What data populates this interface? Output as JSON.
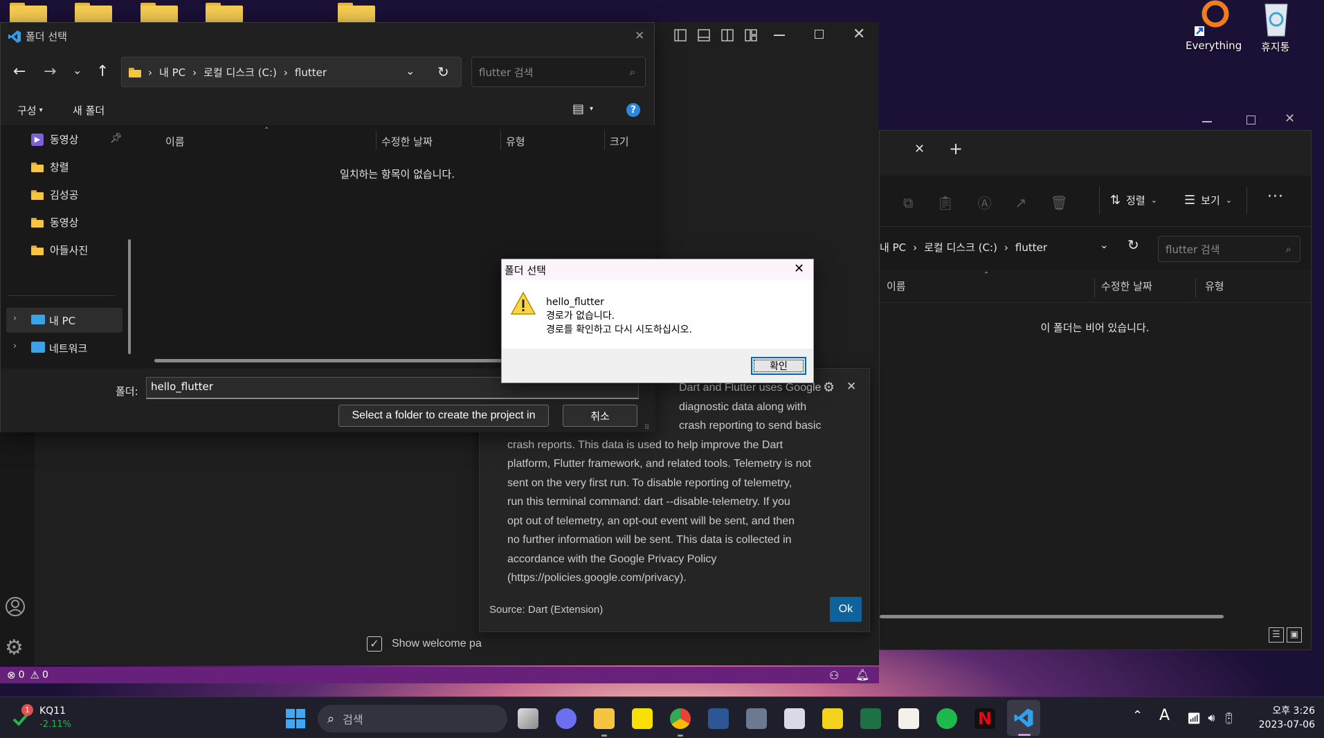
{
  "desktop": {
    "icons": [
      {
        "label": "Everything"
      },
      {
        "label": "휴지통"
      }
    ]
  },
  "vscode": {
    "status": {
      "errors": "0",
      "warnings": "0"
    },
    "welcome_checkbox_label": "Show welcome pa"
  },
  "explorer": {
    "toolbar": {
      "sort_label": "정렬",
      "view_label": "보기"
    },
    "address": {
      "segments": [
        "내 PC",
        "로컬 디스크 (C:)",
        "flutter"
      ]
    },
    "search_placeholder": "flutter 검색",
    "columns": [
      "이름",
      "수정한 날짜",
      "유형"
    ],
    "empty_message": "이 폴더는 비어 있습니다."
  },
  "picker": {
    "title": "폴더 선택",
    "address": {
      "segments": [
        "내 PC",
        "로컬 디스크 (C:)",
        "flutter"
      ]
    },
    "search_placeholder": "flutter 검색",
    "commands": {
      "organize": "구성",
      "new_folder": "새 폴더"
    },
    "nav": {
      "items": [
        "동영상",
        "창렬",
        "김성공",
        "동영상",
        "아들사진"
      ],
      "tree": [
        "내 PC",
        "네트워크"
      ]
    },
    "columns": [
      "이름",
      "수정한 날짜",
      "유형",
      "크기"
    ],
    "empty_message": "일치하는 항목이 없습니다.",
    "folder_label": "폴더:",
    "folder_value": "hello_flutter",
    "select_button": "Select a folder to create the project in",
    "cancel_button": "취소"
  },
  "notification": {
    "lines": [
      "Dart and Flutter uses Google",
      "diagnostic data along with",
      "crash reporting to send basic",
      "crash reports. This data is used to help improve the Dart",
      "platform, Flutter framework, and related tools. Telemetry is not",
      "sent on the very first run. To disable reporting of telemetry,",
      "run this terminal command: dart --disable-telemetry. If you",
      "opt out of telemetry, an opt-out event will be sent, and then",
      "no further information will be sent. This data is collected in",
      "accordance with the Google Privacy Policy",
      "(https://policies.google.com/privacy)."
    ],
    "source": "Source: Dart (Extension)",
    "ok_button": "Ok"
  },
  "msgbox": {
    "title": "폴더 선택",
    "line1": "hello_flutter",
    "line2": "경로가 없습니다.",
    "line3": "경로를 확인하고 다시 시도하십시오.",
    "ok_button": "확인"
  },
  "taskbar": {
    "stock": {
      "badge": "1",
      "symbol": "KQ11",
      "change": "-2.11%"
    },
    "search_placeholder": "검색",
    "ime": "A",
    "clock": {
      "time": "오후 3:26",
      "date": "2023-07-06"
    }
  }
}
